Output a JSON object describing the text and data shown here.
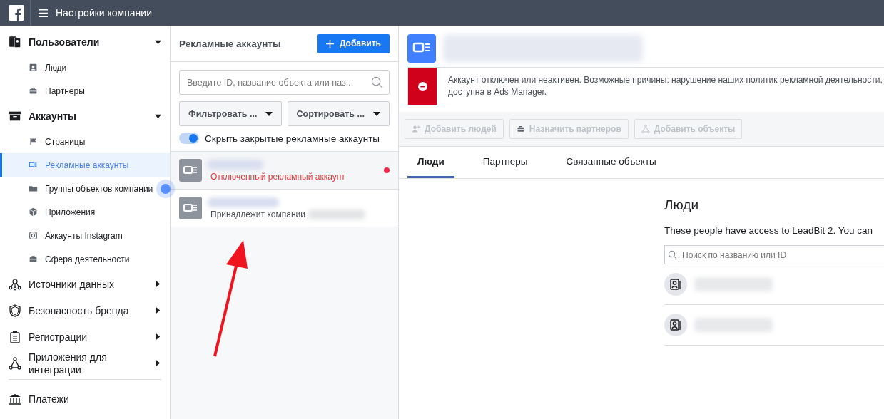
{
  "topbar": {
    "title": "Настройки компании"
  },
  "sidebar": {
    "sections": [
      {
        "label": "Пользователи",
        "expanded": true,
        "items": [
          {
            "label": "Люди",
            "selected": false,
            "hint": false
          },
          {
            "label": "Партнеры",
            "selected": false,
            "hint": false
          }
        ]
      },
      {
        "label": "Аккаунты",
        "expanded": true,
        "items": [
          {
            "label": "Страницы",
            "selected": false,
            "hint": false
          },
          {
            "label": "Рекламные аккаунты",
            "selected": true,
            "hint": false
          },
          {
            "label": "Группы объектов компании",
            "selected": false,
            "hint": true
          },
          {
            "label": "Приложения",
            "selected": false,
            "hint": false
          },
          {
            "label": "Аккаунты Instagram",
            "selected": false,
            "hint": false
          },
          {
            "label": "Сфера деятельности",
            "selected": false,
            "hint": false
          }
        ]
      },
      {
        "label": "Источники данных",
        "expanded": false
      },
      {
        "label": "Безопасность бренда",
        "expanded": false
      },
      {
        "label": "Регистрации",
        "expanded": false
      },
      {
        "label": "Приложения для интеграции",
        "expanded": false
      },
      {
        "label": "Платежи"
      }
    ]
  },
  "accounts_panel": {
    "title": "Рекламные аккаунты",
    "add_button": "Добавить",
    "search": {
      "placeholder": "Введите ID, название объекта или наз..."
    },
    "filter": "Фильтровать ...",
    "sort": "Сортировать ...",
    "toggle": {
      "label": "Скрыть закрытые рекламные аккаунты",
      "on": true
    },
    "accounts": [
      {
        "kind": "disabled",
        "status": "Отключенный рекламный аккаунт",
        "selected": true,
        "alert": true
      },
      {
        "kind": "owned",
        "status": "Принадлежит компании",
        "selected": false,
        "alert": false
      }
    ]
  },
  "detail": {
    "alert": {
      "lines": [
        "Аккаунт отключен или неактивен. Возможные причины: нарушение наших политик рекламной деятельности,",
        "доступна в Ads Manager."
      ]
    },
    "actions": [
      {
        "label": "Добавить людей",
        "disabled": true
      },
      {
        "label": "Назначить партнеров",
        "disabled": true
      },
      {
        "label": "Добавить объекты",
        "disabled": true
      }
    ],
    "tabs": [
      {
        "label": "Люди",
        "selected": true
      },
      {
        "label": "Партнеры",
        "selected": false
      },
      {
        "label": "Связанные объекты",
        "selected": false
      }
    ],
    "people": {
      "heading": "Люди",
      "description": "These people have access to LeadBit 2. You can",
      "search": {
        "placeholder": "Поиск по названию или ID"
      },
      "rows": [
        {
          "kind": "user"
        },
        {
          "kind": "user"
        }
      ]
    }
  }
}
